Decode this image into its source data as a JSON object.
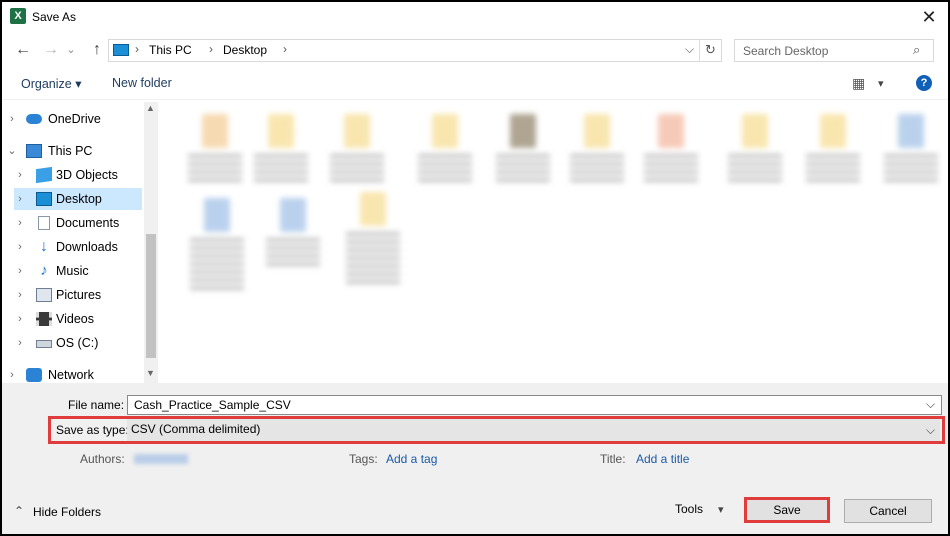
{
  "window": {
    "title": "Save As",
    "app_icon_letter": "X",
    "close_glyph": "✕"
  },
  "navigation": {
    "back_glyph": "←",
    "forward_glyph": "→",
    "up_glyph": "↑",
    "breadcrumbs": [
      "This PC",
      "Desktop"
    ],
    "crumb_sep": "›",
    "dropdown_glyph": "⌵",
    "refresh_glyph": "↻",
    "search_placeholder": "Search Desktop",
    "search_glyph": "⌕"
  },
  "toolbar": {
    "organize_label": "Organize ▾",
    "new_folder_label": "New folder",
    "view_glyph": "▦",
    "view_menu_glyph": "▾",
    "help_glyph": "?"
  },
  "sidebar": {
    "items": [
      {
        "label": "OneDrive",
        "icon": "cloud-icon",
        "color": "#2b83d6"
      },
      {
        "label": "This PC",
        "icon": "computer-icon",
        "color": "#3a8ad8"
      },
      {
        "label": "3D Objects",
        "icon": "cube-icon",
        "color": "#3aa0e6"
      },
      {
        "label": "Desktop",
        "icon": "desktop-icon",
        "color": "#1b8fd6"
      },
      {
        "label": "Documents",
        "icon": "document-icon",
        "color": "#8a97a6"
      },
      {
        "label": "Downloads",
        "icon": "download-icon",
        "color": "#2c6fd1"
      },
      {
        "label": "Music",
        "icon": "music-icon",
        "color": "#1c75d0"
      },
      {
        "label": "Pictures",
        "icon": "picture-icon",
        "color": "#6f7f93"
      },
      {
        "label": "Videos",
        "icon": "video-icon",
        "color": "#3a3a3a"
      },
      {
        "label": "OS (C:)",
        "icon": "drive-icon",
        "color": "#6f7f93"
      },
      {
        "label": "Network",
        "icon": "network-icon",
        "color": "#2b83d6"
      }
    ],
    "expander_glyph": "›",
    "expanded_glyph": "⌄"
  },
  "form": {
    "file_name_label": "File name:",
    "file_name_value": "Cash_Practice_Sample_CSV",
    "save_type_label": "Save as type:",
    "save_type_value": "CSV (Comma delimited)",
    "dropdown_glyph": "⌵",
    "authors_label": "Authors:",
    "tags_label": "Tags:",
    "tags_link": "Add a tag",
    "title_label": "Title:",
    "title_link": "Add a title"
  },
  "footer": {
    "hide_folders_label": "Hide Folders",
    "hide_glyph": "⌃",
    "tools_label": "Tools",
    "tools_glyph": "▾",
    "save_label": "Save",
    "cancel_label": "Cancel"
  },
  "colors": {
    "highlight": "#e03c3c",
    "selection": "#cce8ff",
    "link": "#1a5aa6"
  }
}
